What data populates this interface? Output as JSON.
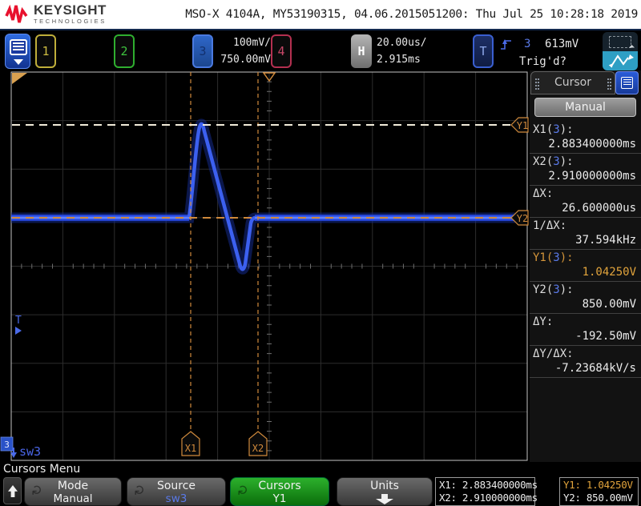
{
  "header": {
    "brand_name": "KEYSIGHT",
    "brand_sub": "TECHNOLOGIES",
    "title": "MSO-X 4104A, MY53190315, 04.06.2015051200: Thu Jul 25 10:28:18 2019"
  },
  "channel_bar": {
    "ch1": "1",
    "ch2": "2",
    "ch3": "3",
    "ch4": "4",
    "ch3_scale": "100mV/",
    "ch3_offset": "750.00mV",
    "h_key": "H",
    "timebase": "20.00us/",
    "delay": "2.915ms",
    "t_key": "T",
    "trigger_source": "3",
    "trigger_level": "613mV",
    "trigger_status": "Trig'd?"
  },
  "plot": {
    "trace_color": "#3c60f0",
    "cursor_color": "#d08a3c",
    "trigger_level_marker": "T",
    "ground_channel": "3",
    "source_label": "sw3",
    "x1_tag": "X1",
    "x2_tag": "X2",
    "y1_tag": "Y1",
    "y2_tag": "Y2"
  },
  "sidebar": {
    "title": "Cursor",
    "mode": "Manual",
    "rows": [
      {
        "pre": "X1(",
        "src": "3",
        "post": "):",
        "value": "2.883400000ms"
      },
      {
        "pre": "X2(",
        "src": "3",
        "post": "):",
        "value": "2.910000000ms"
      },
      {
        "pre": "ΔX:",
        "src": "",
        "post": "",
        "value": "26.600000us"
      },
      {
        "pre": "1/ΔX:",
        "src": "",
        "post": "",
        "value": "37.594kHz"
      },
      {
        "pre": "Y1(",
        "src": "3",
        "post": "):",
        "value": "1.04250V"
      },
      {
        "pre": "Y2(",
        "src": "3",
        "post": "):",
        "value": "850.00mV"
      },
      {
        "pre": "ΔY:",
        "src": "",
        "post": "",
        "value": "-192.50mV"
      },
      {
        "pre": "ΔY/ΔX:",
        "src": "",
        "post": "",
        "value": "-7.23684kV/s"
      }
    ]
  },
  "bottom": {
    "menu_title": "Cursors Menu",
    "knob_icon": "↻",
    "mode_key": {
      "top": "Mode",
      "bottom": "Manual"
    },
    "source_key": {
      "top": "Source",
      "bottom": "sw3"
    },
    "cursors_key": {
      "top": "Cursors",
      "bottom": "Y1"
    },
    "units_key": {
      "top": "Units"
    },
    "readout_x1": "X1: 2.883400000ms",
    "readout_x2": "X2: 2.910000000ms",
    "readout_y1": "Y1: 1.04250V",
    "readout_y2": "Y2: 850.00mV"
  }
}
